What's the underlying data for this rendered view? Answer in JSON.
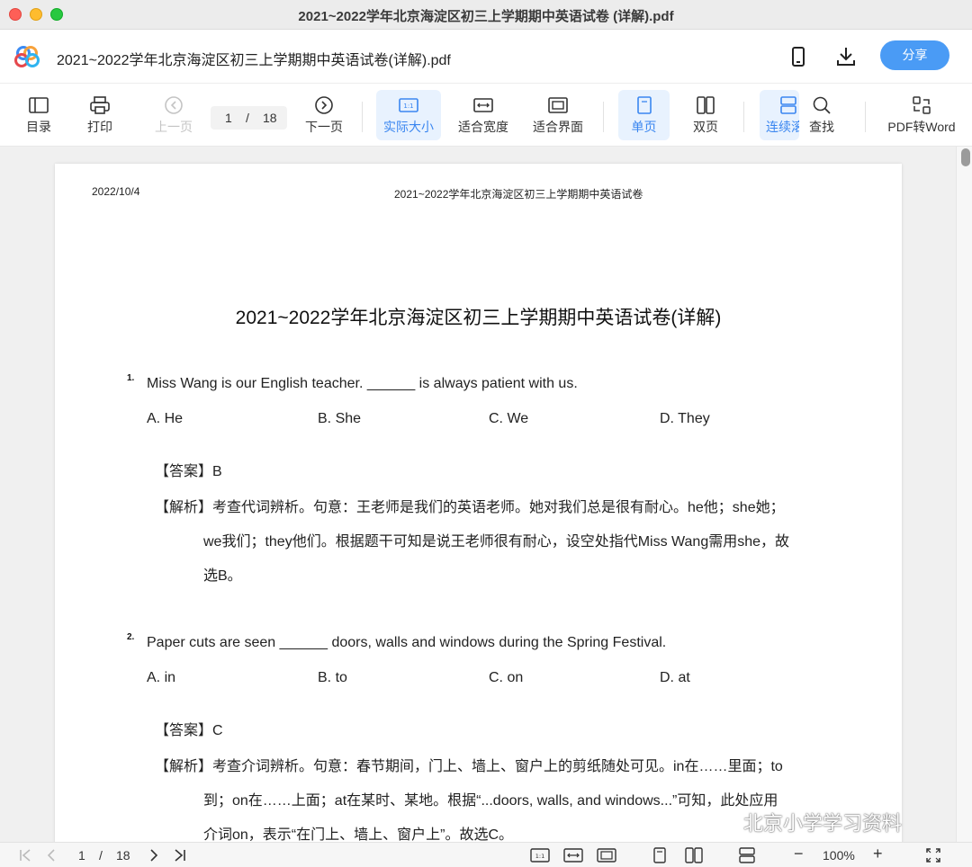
{
  "window": {
    "title": "2021~2022学年北京海淀区初三上学期期中英语试卷 (详解).pdf"
  },
  "header": {
    "doc_title": "2021~2022学年北京海淀区初三上学期期中英语试卷(详解).pdf",
    "share_label": "分享",
    "icons": [
      "mobile-icon",
      "download-icon"
    ]
  },
  "toolbar": {
    "toc": "目录",
    "print": "打印",
    "prev": "上一页",
    "page_current": "1",
    "page_sep": "/",
    "page_total": "18",
    "next": "下一页",
    "actual_size": "实际大小",
    "fit_width": "适合宽度",
    "fit_page": "适合界面",
    "single": "单页",
    "double": "双页",
    "continuous": "连续滚",
    "find": "查找",
    "pdf_to_word": "PDF转Word",
    "accent_color": "#3a86f0"
  },
  "page": {
    "date": "2022/10/4",
    "running_head": "2021~2022学年北京海淀区初三上学期期中英语试卷",
    "title": "2021~2022学年北京海淀区初三上学期期中英语试卷(详解)",
    "questions": [
      {
        "num": "1.",
        "text": "Miss Wang is our English teacher. ______ is always patient with us.",
        "options": [
          "A. He",
          "B. She",
          "C. We",
          "D. They"
        ],
        "answer": "【答案】B",
        "explanation": [
          "【解析】考查代词辨析。句意：王老师是我们的英语老师。她对我们总是很有耐心。he他；she她；",
          "we我们；they他们。根据题干可知是说王老师很有耐心，设空处指代Miss Wang需用she，故",
          "选B。"
        ]
      },
      {
        "num": "2.",
        "text": "Paper cuts are seen ______ doors, walls and windows during the Spring Festival.",
        "options": [
          "A. in",
          "B. to",
          "C. on",
          "D. at"
        ],
        "answer": "【答案】C",
        "explanation": [
          "【解析】考查介词辨析。句意：春节期间，门上、墙上、窗户上的剪纸随处可见。in在……里面；to",
          "到；on在……上面；at在某时、某地。根据“...doors, walls, and windows...”可知，此处应用",
          "介词on，表示“在门上、墙上、窗户上”。故选C。"
        ]
      }
    ]
  },
  "statusbar": {
    "page_current": "1",
    "page_sep": "/",
    "page_total": "18",
    "zoom": "100%",
    "zoom_out": "−",
    "zoom_in": "+"
  },
  "watermark": "北京小学学习资料"
}
